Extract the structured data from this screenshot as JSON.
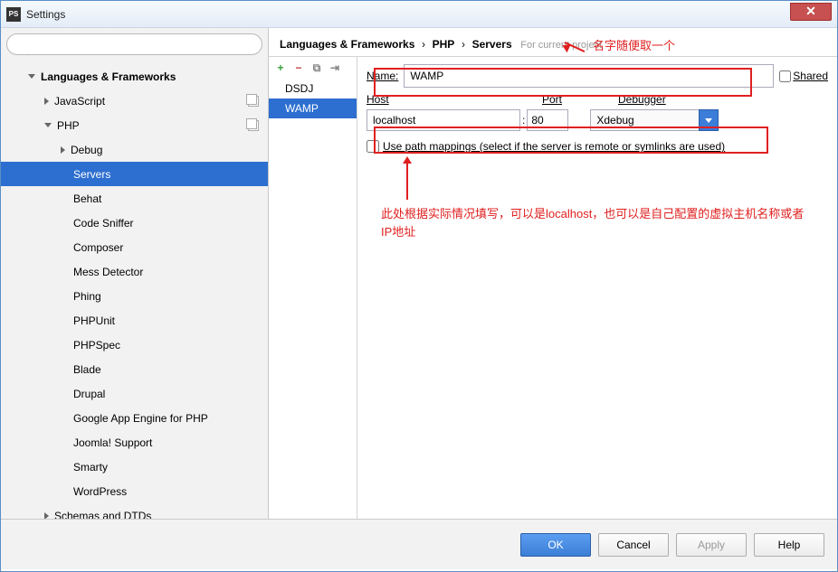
{
  "window": {
    "title": "Settings"
  },
  "search": {
    "placeholder": ""
  },
  "tree": {
    "root": "Languages & Frameworks",
    "items": [
      {
        "label": "JavaScript"
      },
      {
        "label": "PHP"
      }
    ],
    "php_children": [
      "Debug",
      "Servers",
      "Behat",
      "Code Sniffer",
      "Composer",
      "Mess Detector",
      "Phing",
      "PHPUnit",
      "PHPSpec",
      "Blade",
      "Drupal",
      "Google App Engine for PHP",
      "Joomla! Support",
      "Smarty",
      "WordPress"
    ],
    "schemas": "Schemas and DTDs"
  },
  "breadcrumb": {
    "p1": "Languages & Frameworks",
    "p2": "PHP",
    "p3": "Servers",
    "suffix": "For current project"
  },
  "servers": {
    "list": [
      "DSDJ",
      "WAMP"
    ]
  },
  "form": {
    "name_label": "Name:",
    "name_value": "WAMP",
    "shared": "Shared",
    "host_label": "Host",
    "host_value": "localhost",
    "port_label": "Port",
    "port_value": "80",
    "debugger_label": "Debugger",
    "debugger_value": "Xdebug",
    "mapping": "Use path mappings (select if the server is remote or symlinks are used)"
  },
  "annotations": {
    "a1": "名字随便取一个",
    "a2": "此处根据实际情况填写，可以是localhost，也可以是自己配置的虚拟主机名称或者IP地址"
  },
  "footer": {
    "ok": "OK",
    "cancel": "Cancel",
    "apply": "Apply",
    "help": "Help"
  }
}
